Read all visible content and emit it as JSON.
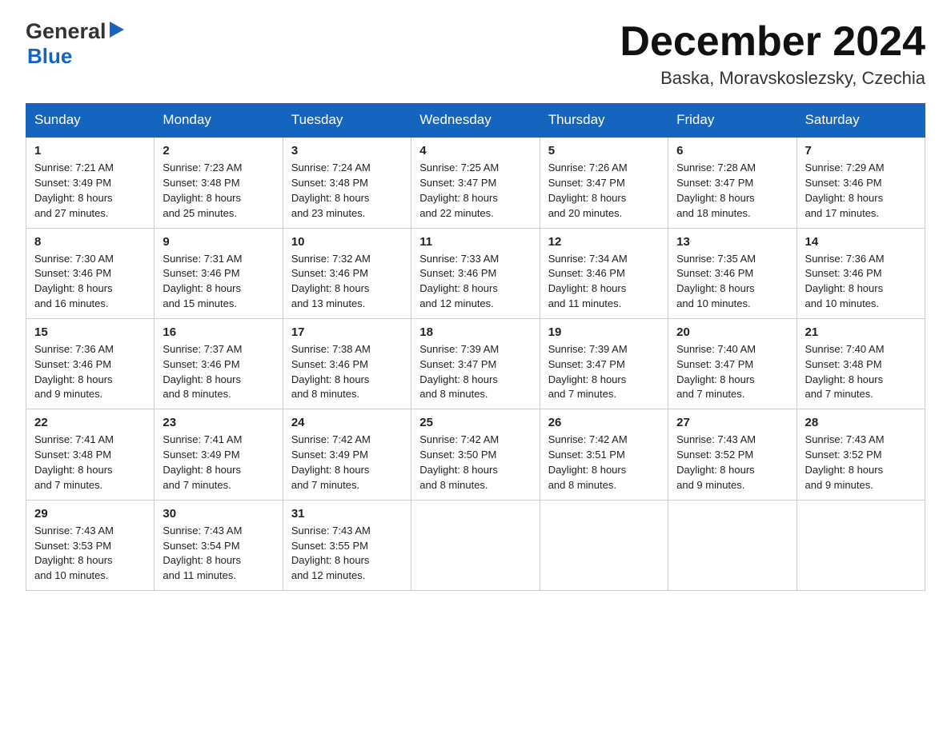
{
  "header": {
    "month_title": "December 2024",
    "location": "Baska, Moravskoslezsky, Czechia",
    "logo_top": "General",
    "logo_bottom": "Blue"
  },
  "days_of_week": [
    "Sunday",
    "Monday",
    "Tuesday",
    "Wednesday",
    "Thursday",
    "Friday",
    "Saturday"
  ],
  "weeks": [
    [
      {
        "day": "1",
        "sunrise": "7:21 AM",
        "sunset": "3:49 PM",
        "daylight": "8 hours and 27 minutes."
      },
      {
        "day": "2",
        "sunrise": "7:23 AM",
        "sunset": "3:48 PM",
        "daylight": "8 hours and 25 minutes."
      },
      {
        "day": "3",
        "sunrise": "7:24 AM",
        "sunset": "3:48 PM",
        "daylight": "8 hours and 23 minutes."
      },
      {
        "day": "4",
        "sunrise": "7:25 AM",
        "sunset": "3:47 PM",
        "daylight": "8 hours and 22 minutes."
      },
      {
        "day": "5",
        "sunrise": "7:26 AM",
        "sunset": "3:47 PM",
        "daylight": "8 hours and 20 minutes."
      },
      {
        "day": "6",
        "sunrise": "7:28 AM",
        "sunset": "3:47 PM",
        "daylight": "8 hours and 18 minutes."
      },
      {
        "day": "7",
        "sunrise": "7:29 AM",
        "sunset": "3:46 PM",
        "daylight": "8 hours and 17 minutes."
      }
    ],
    [
      {
        "day": "8",
        "sunrise": "7:30 AM",
        "sunset": "3:46 PM",
        "daylight": "8 hours and 16 minutes."
      },
      {
        "day": "9",
        "sunrise": "7:31 AM",
        "sunset": "3:46 PM",
        "daylight": "8 hours and 15 minutes."
      },
      {
        "day": "10",
        "sunrise": "7:32 AM",
        "sunset": "3:46 PM",
        "daylight": "8 hours and 13 minutes."
      },
      {
        "day": "11",
        "sunrise": "7:33 AM",
        "sunset": "3:46 PM",
        "daylight": "8 hours and 12 minutes."
      },
      {
        "day": "12",
        "sunrise": "7:34 AM",
        "sunset": "3:46 PM",
        "daylight": "8 hours and 11 minutes."
      },
      {
        "day": "13",
        "sunrise": "7:35 AM",
        "sunset": "3:46 PM",
        "daylight": "8 hours and 10 minutes."
      },
      {
        "day": "14",
        "sunrise": "7:36 AM",
        "sunset": "3:46 PM",
        "daylight": "8 hours and 10 minutes."
      }
    ],
    [
      {
        "day": "15",
        "sunrise": "7:36 AM",
        "sunset": "3:46 PM",
        "daylight": "8 hours and 9 minutes."
      },
      {
        "day": "16",
        "sunrise": "7:37 AM",
        "sunset": "3:46 PM",
        "daylight": "8 hours and 8 minutes."
      },
      {
        "day": "17",
        "sunrise": "7:38 AM",
        "sunset": "3:46 PM",
        "daylight": "8 hours and 8 minutes."
      },
      {
        "day": "18",
        "sunrise": "7:39 AM",
        "sunset": "3:47 PM",
        "daylight": "8 hours and 8 minutes."
      },
      {
        "day": "19",
        "sunrise": "7:39 AM",
        "sunset": "3:47 PM",
        "daylight": "8 hours and 7 minutes."
      },
      {
        "day": "20",
        "sunrise": "7:40 AM",
        "sunset": "3:47 PM",
        "daylight": "8 hours and 7 minutes."
      },
      {
        "day": "21",
        "sunrise": "7:40 AM",
        "sunset": "3:48 PM",
        "daylight": "8 hours and 7 minutes."
      }
    ],
    [
      {
        "day": "22",
        "sunrise": "7:41 AM",
        "sunset": "3:48 PM",
        "daylight": "8 hours and 7 minutes."
      },
      {
        "day": "23",
        "sunrise": "7:41 AM",
        "sunset": "3:49 PM",
        "daylight": "8 hours and 7 minutes."
      },
      {
        "day": "24",
        "sunrise": "7:42 AM",
        "sunset": "3:49 PM",
        "daylight": "8 hours and 7 minutes."
      },
      {
        "day": "25",
        "sunrise": "7:42 AM",
        "sunset": "3:50 PM",
        "daylight": "8 hours and 8 minutes."
      },
      {
        "day": "26",
        "sunrise": "7:42 AM",
        "sunset": "3:51 PM",
        "daylight": "8 hours and 8 minutes."
      },
      {
        "day": "27",
        "sunrise": "7:43 AM",
        "sunset": "3:52 PM",
        "daylight": "8 hours and 9 minutes."
      },
      {
        "day": "28",
        "sunrise": "7:43 AM",
        "sunset": "3:52 PM",
        "daylight": "8 hours and 9 minutes."
      }
    ],
    [
      {
        "day": "29",
        "sunrise": "7:43 AM",
        "sunset": "3:53 PM",
        "daylight": "8 hours and 10 minutes."
      },
      {
        "day": "30",
        "sunrise": "7:43 AM",
        "sunset": "3:54 PM",
        "daylight": "8 hours and 11 minutes."
      },
      {
        "day": "31",
        "sunrise": "7:43 AM",
        "sunset": "3:55 PM",
        "daylight": "8 hours and 12 minutes."
      },
      null,
      null,
      null,
      null
    ]
  ],
  "cell_labels": {
    "sunrise": "Sunrise: ",
    "sunset": "Sunset: ",
    "daylight": "Daylight: "
  }
}
